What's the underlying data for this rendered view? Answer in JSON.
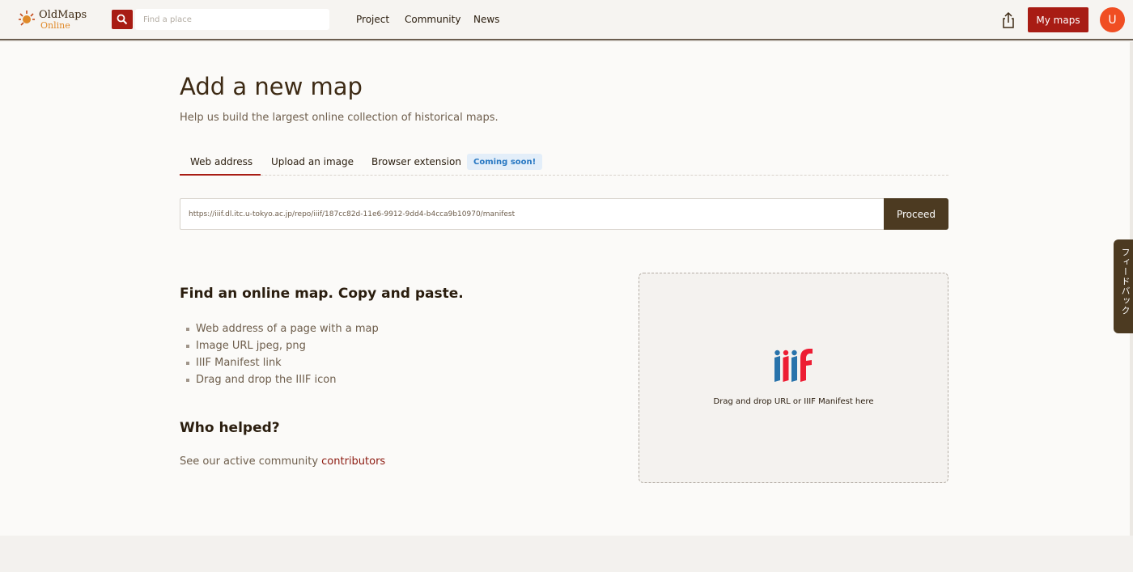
{
  "header": {
    "logo_line1": "OldMaps",
    "logo_line2": "Online",
    "search_placeholder": "Find a place",
    "nav": [
      "Project",
      "Community",
      "News"
    ],
    "my_maps_label": "My maps",
    "avatar_initial": "U",
    "accent_color": "#a81c14",
    "avatar_color": "#f04e23"
  },
  "main": {
    "title": "Add a new map",
    "subtitle": "Help us build the largest online collection of historical maps.",
    "tabs": [
      {
        "label": "Web address",
        "active": true
      },
      {
        "label": "Upload an image",
        "active": false
      },
      {
        "label": "Browser extension",
        "active": false
      }
    ],
    "coming_soon_badge": "Coming soon!",
    "url_value": "https://iiif.dl.itc.u-tokyo.ac.jp/repo/iiif/187cc82d-11e6-9912-9dd4-b4cca9b10970/manifest",
    "proceed_label": "Proceed",
    "find_heading": "Find an online map. Copy and paste.",
    "find_items": [
      "Web address of a page with a map",
      "Image URL jpeg, png",
      "IIIF Manifest link",
      "Drag and drop the IIIF icon"
    ],
    "helped_heading": "Who helped?",
    "helped_text": "See our active community",
    "helped_link": "contributors",
    "dropzone_text": "Drag and drop URL or IIIF Manifest here",
    "dropzone_icon": "iiif-logo"
  },
  "feedback": {
    "label": "フィードバック",
    "color": "#4c3a21"
  }
}
